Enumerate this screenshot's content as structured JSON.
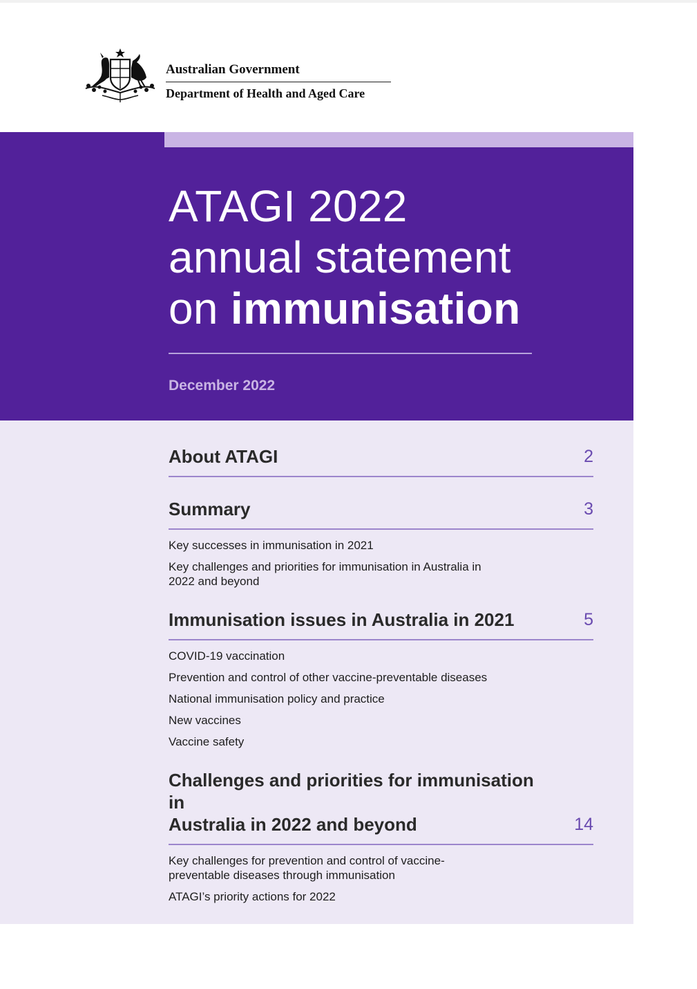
{
  "header": {
    "gov_line1": "Australian Government",
    "gov_line2": "Department of Health and Aged Care"
  },
  "title": {
    "line1": "ATAGI 2022",
    "line2": "annual statement",
    "line3_prefix": "on ",
    "line3_bold": "immunisation"
  },
  "date": "December 2022",
  "toc": {
    "about": {
      "heading": "About ATAGI",
      "page": "2"
    },
    "summary": {
      "heading": "Summary",
      "page": "3",
      "items": [
        "Key successes in immunisation in 2021",
        "Key challenges and priorities for immunisation in Australia in 2022 and beyond"
      ]
    },
    "issues": {
      "heading": "Immunisation issues in Australia in 2021",
      "page": "5",
      "items": [
        "COVID-19 vaccination",
        "Prevention and control of other vaccine-preventable diseases",
        "National immunisation policy and practice",
        "New vaccines",
        "Vaccine safety"
      ]
    },
    "challenges": {
      "heading_line1": "Challenges and priorities for immunisation in",
      "heading_line2": "Australia in 2022 and beyond",
      "page": "14",
      "items": [
        "Key challenges for prevention and control of vaccine-preventable diseases through immunisation",
        "ATAGI’s priority actions for 2022"
      ]
    }
  },
  "colors": {
    "brand_purple": "#52219a",
    "accent_lavender": "#c9b4e4",
    "panel_background": "#ede8f5",
    "rule_purple": "#9c85cc"
  }
}
